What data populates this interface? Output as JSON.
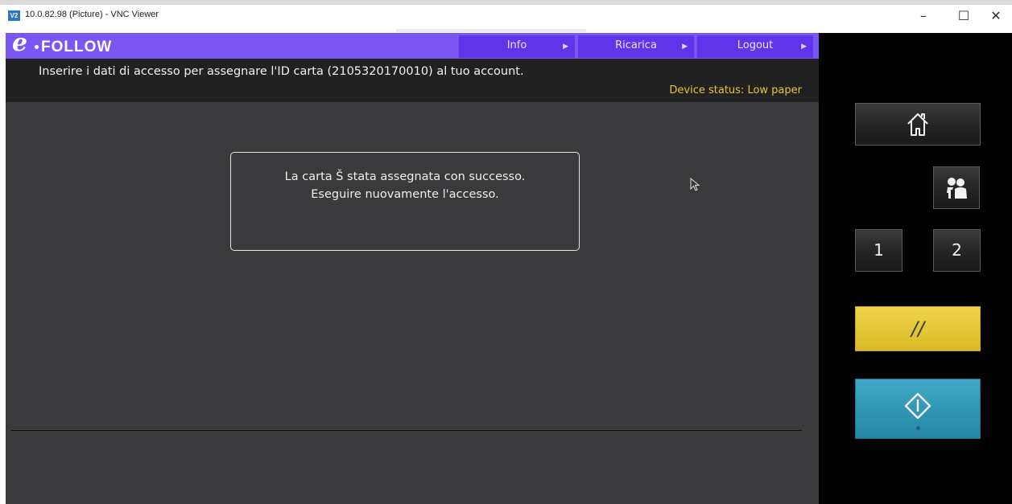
{
  "window": {
    "title": "10.0.82.98 (Picture) - VNC Viewer",
    "app_icon_text": "V2",
    "controls": {
      "minimize": "–",
      "maximize": "☐",
      "close": "✕"
    }
  },
  "brand": {
    "logo_letter": "e",
    "logo_word": "FOLLOW"
  },
  "nav": [
    {
      "label": "Info"
    },
    {
      "label": "Ricarica"
    },
    {
      "label": "Logout"
    }
  ],
  "header": {
    "instruction": "Inserire i dati di accesso per assegnare l'ID carta (2105320170010) al tuo account.",
    "device_status": "Device status: Low paper"
  },
  "dialog": {
    "line1": "La carta Š stata assegnata con successo.",
    "line2": "Eseguire nuovamente l'accesso."
  },
  "panel": {
    "home_icon": "home-icon",
    "user_icon": "users-icon",
    "num1": "1",
    "num2": "2",
    "reset_symbol": "//",
    "start_icon": "start-icon"
  },
  "colors": {
    "nav_bar": "#7a57f2",
    "nav_button": "#5f35ea",
    "status_text": "#e8c43a",
    "reset_button": "#e3c435",
    "start_button": "#2f97b7"
  }
}
